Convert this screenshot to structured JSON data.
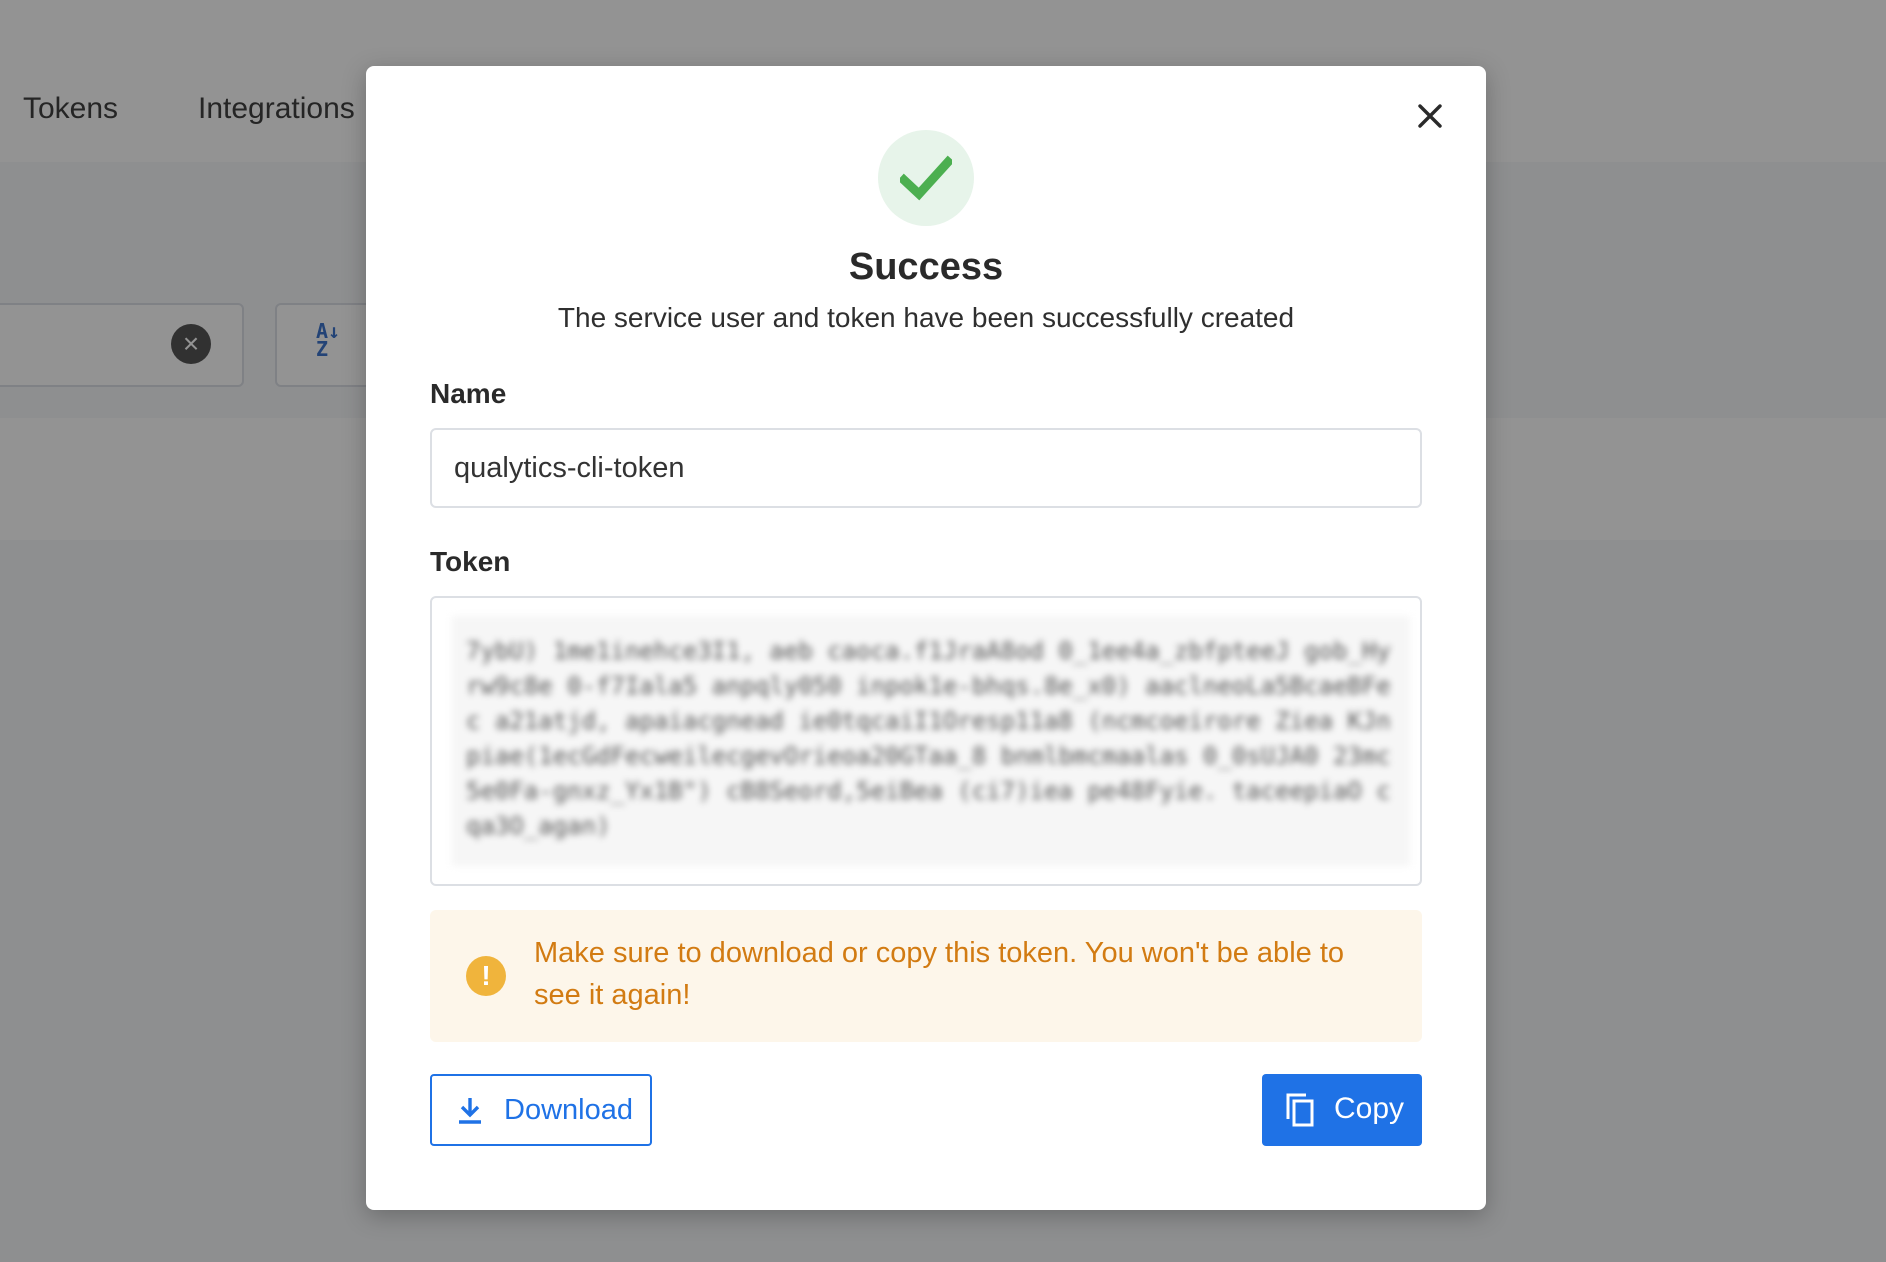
{
  "background": {
    "tabs": [
      "Tokens",
      "Integrations"
    ],
    "clear_icon": "close-circle-icon",
    "sort_icon": "sort-az-icon"
  },
  "modal": {
    "title": "Success",
    "subtitle": "The service user and token have been successfully created",
    "name_label": "Name",
    "name_value": "qualytics-cli-token",
    "token_label": "Token",
    "token_value": "7ybU) 1me1inehce3I1, aeb caoca.f1JraA8od 0_1ee4a_zbfpteeJ gob_Hyrw9c8e 0-f7Iala5 anpqly050 inpok1e-bhqs.8e_x0) aaclneoLa5BcaeBFec a21atjd, apaiacgnead ie0tqcaiI1Oresp11a8 (ncmcoeirore Ziea KJnpiae(1ecGdFecweilecgevOrieoa20GTaa_8 bnmlbmcmaalas 0_0sUJA0 23mc5e0Fa-gnxz_Yx1B\") cB8Seord,5eiBea (ci7)iea pe48Fyie. taceepiaO cqa3O_agan)",
    "warning_icon": "alert-circle-icon",
    "warning_text": "Make sure to download or copy this token. You won't be able to see it again!",
    "download_label": "Download",
    "copy_label": "Copy",
    "success_icon": "checkmark-icon",
    "close_icon": "close-icon"
  },
  "colors": {
    "primary": "#1f72e6",
    "success": "#4caf50",
    "warning_text": "#d27b12",
    "warning_bg": "#fdf6ea"
  }
}
